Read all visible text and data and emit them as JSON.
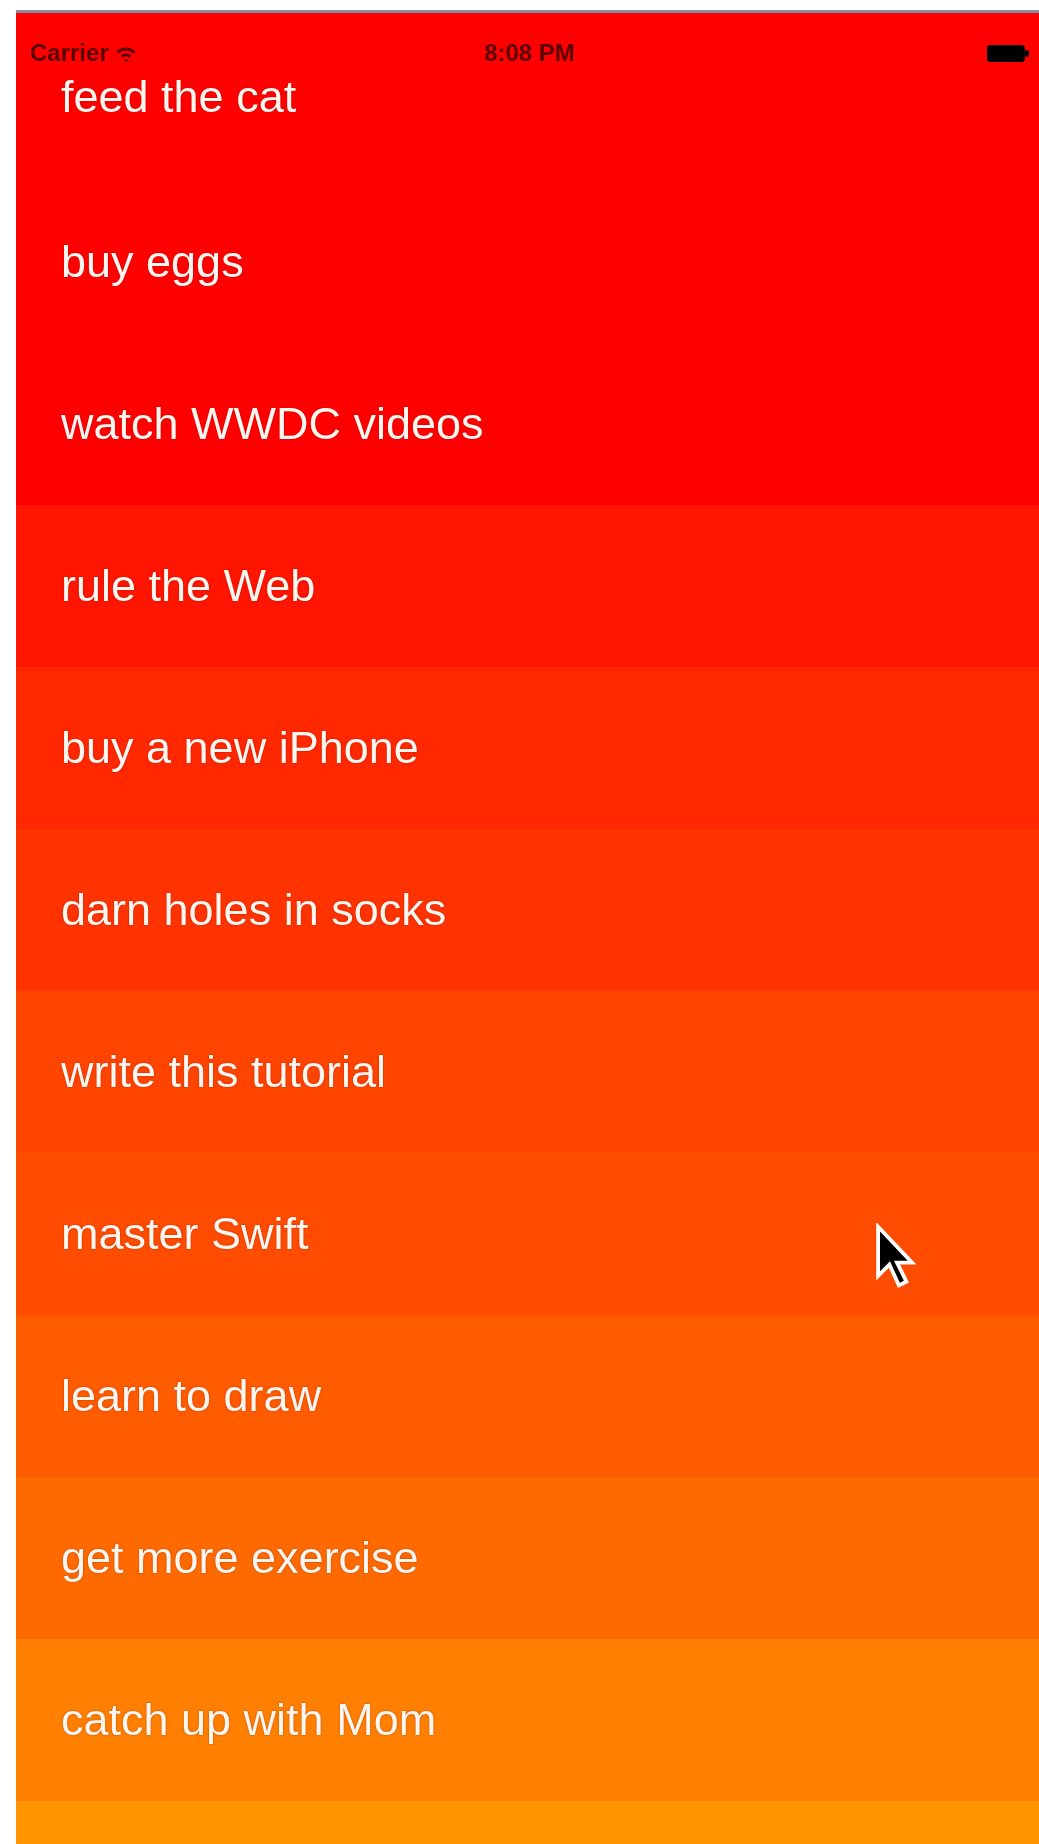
{
  "status_bar": {
    "carrier": "Carrier",
    "time": "8:08 PM"
  },
  "rows": [
    {
      "label": "feed the cat",
      "color": "#ff0000"
    },
    {
      "label": "buy eggs",
      "color": "#ff0000"
    },
    {
      "label": "watch WWDC videos",
      "color": "#ff0000"
    },
    {
      "label": "rule the Web",
      "color": "#ff1500"
    },
    {
      "label": "buy a new iPhone",
      "color": "#ff2800"
    },
    {
      "label": "darn holes in socks",
      "color": "#ff3300"
    },
    {
      "label": "write this tutorial",
      "color": "#ff4400"
    },
    {
      "label": "master Swift",
      "color": "#ff4c00"
    },
    {
      "label": "learn to draw",
      "color": "#ff5c00"
    },
    {
      "label": "get more exercise",
      "color": "#ff6a00"
    },
    {
      "label": "catch up with Mom",
      "color": "#ff7f00"
    },
    {
      "color": "#ff9400"
    }
  ]
}
